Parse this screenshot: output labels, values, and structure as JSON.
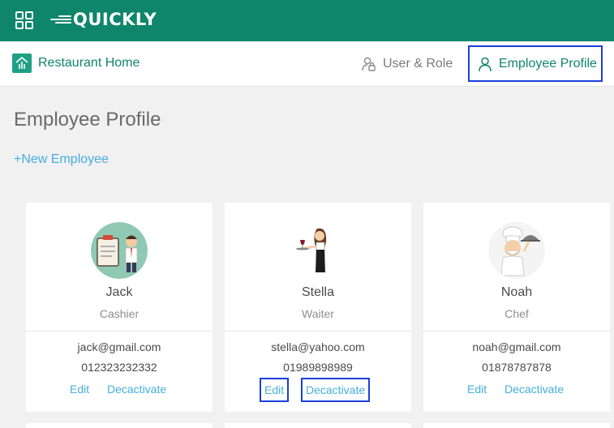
{
  "topbar": {
    "logo_text": "QUICKLY",
    "bg_color": "#0f866c"
  },
  "subnav": {
    "home_label": "Restaurant Home",
    "user_role_label": "User & Role",
    "employee_profile_label": "Employee Profile"
  },
  "page": {
    "title": "Employee Profile",
    "new_employee_label": "+New Employee"
  },
  "employees": [
    {
      "name": "Jack",
      "role": "Cashier",
      "email": "jack@gmail.com",
      "phone": "012323232332",
      "edit_label": "Edit",
      "deactivate_label": "Decactivate",
      "avatar_icon": "cashier-avatar-icon"
    },
    {
      "name": "Stella",
      "role": "Waiter",
      "email": "stella@yahoo.com",
      "phone": "01989898989",
      "edit_label": "Edit",
      "deactivate_label": "Decactivate",
      "avatar_icon": "waiter-avatar-icon"
    },
    {
      "name": "Noah",
      "role": "Chef",
      "email": "noah@gmail.com",
      "phone": "01878787878",
      "edit_label": "Edit",
      "deactivate_label": "Decactivate",
      "avatar_icon": "chef-avatar-icon"
    }
  ],
  "colors": {
    "brand": "#0f866c",
    "link": "#45aede",
    "highlight": "#1a3fdc"
  }
}
